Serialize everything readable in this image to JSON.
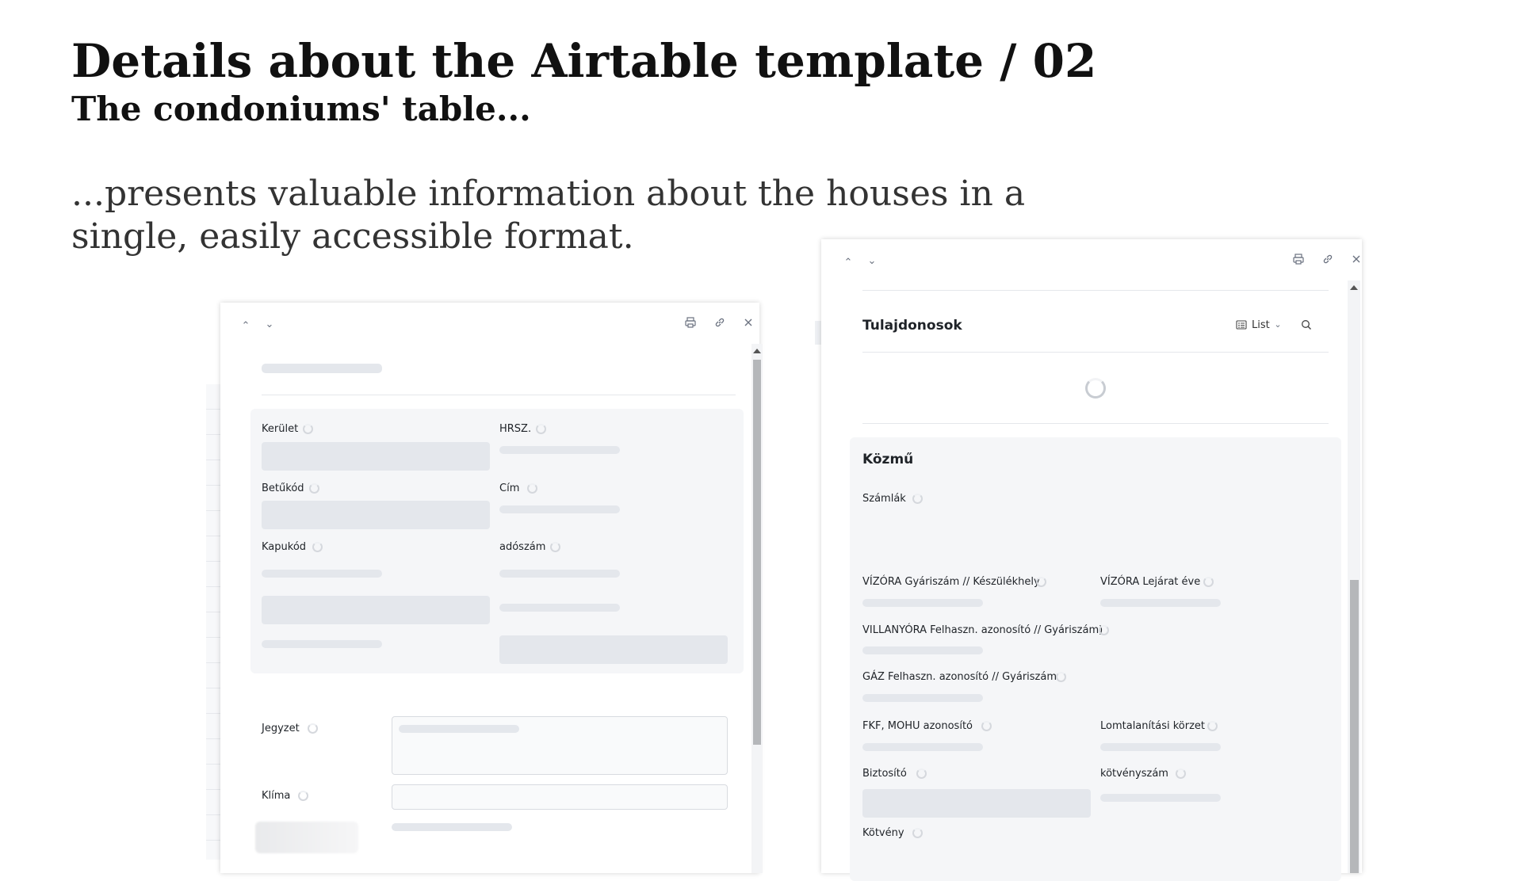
{
  "slide": {
    "title": "Details about the Airtable template / 02",
    "subtitle": "The condoniums' table...",
    "body": "...presents valuable information about the houses in a single, easily accessible format."
  },
  "left_dialog": {
    "icons": [
      "chevron-up-icon",
      "chevron-down-icon",
      "print-icon",
      "link-icon",
      "close-icon"
    ],
    "fields": {
      "kerulet": "Kerület",
      "hrsz": "HRSZ.",
      "betukod": "Betűkód",
      "cim": "Cím",
      "kapukod": "Kapukód",
      "adoszam": "adószám",
      "jegyzet": "Jegyzet",
      "klima": "Klíma"
    }
  },
  "right_dialog": {
    "icons": [
      "chevron-up-icon",
      "chevron-down-icon",
      "print-icon",
      "link-icon",
      "close-icon",
      "list-icon",
      "search-icon"
    ],
    "linked_section_title": "Tulajdonosok",
    "view_selector": "List",
    "section_title": "Közmű",
    "fields": {
      "szamlak": "Számlák",
      "vizora_gyariszam": "VÍZÓRA Gyáriszám // Készülékhely",
      "vizora_lejarat": "VÍZÓRA Lejárat éve",
      "villanyora": "VILLANYÓRA Felhaszn. azonosító // Gyáriszám)",
      "gaz": "GÁZ Felhaszn. azonosító // Gyáriszám",
      "fkf": "FKF, MOHU azonosító",
      "lomtalanitasi": "Lomtalanítási körzet",
      "biztosito": "Biztosító",
      "kotvenyszam": "kötvényszám",
      "kotveny": "Kötvény"
    }
  }
}
